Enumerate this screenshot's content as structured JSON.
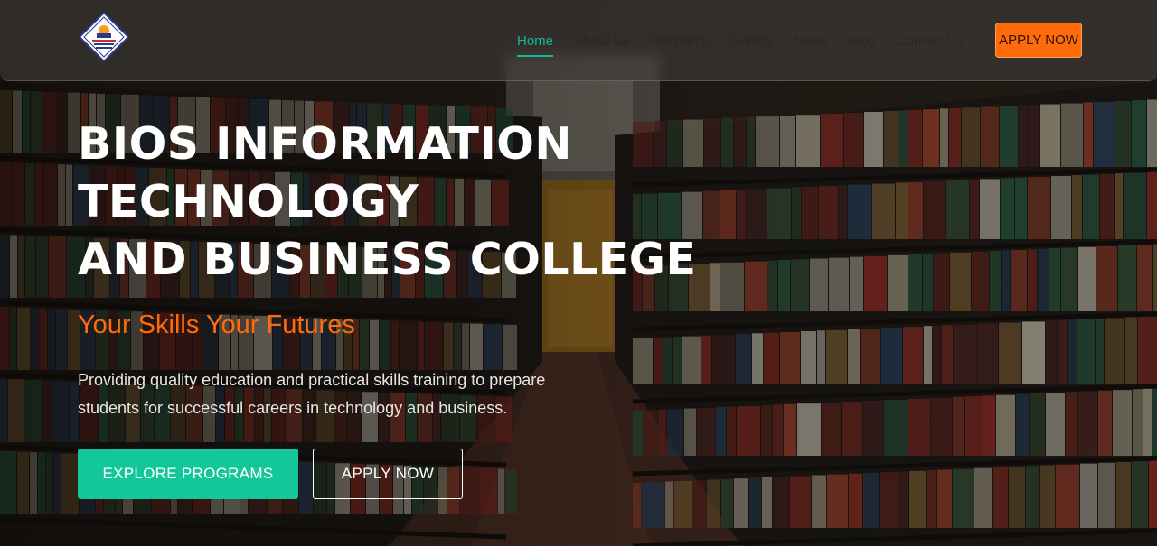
{
  "nav": {
    "logo_icon": "college-crest-logo",
    "links": [
      {
        "label": "Home",
        "active": true
      },
      {
        "label": "About Us",
        "active": false
      },
      {
        "label": "Programs",
        "active": false
      },
      {
        "label": "Gallery",
        "active": false
      },
      {
        "label": "News",
        "active": false
      },
      {
        "label": "Blog",
        "active": false
      },
      {
        "label": "Contact Us",
        "active": false
      }
    ],
    "apply_label": "APPLY NOW"
  },
  "hero": {
    "title_lines": [
      "BIOS INFORMATION",
      "TECHNOLOGY",
      "AND BUSINESS COLLEGE"
    ],
    "tagline": "Your Skills Your Futures",
    "description_lines": [
      "Providing quality education and practical skills training to prepare",
      "students for successful careers in technology and business."
    ],
    "explore_label": "EXPLORE PROGRAMS",
    "apply_label": "APPLY NOW"
  },
  "colors": {
    "accent_teal": "#14c79a",
    "accent_orange": "#ff6b0a",
    "nav_active": "#14b89a"
  }
}
